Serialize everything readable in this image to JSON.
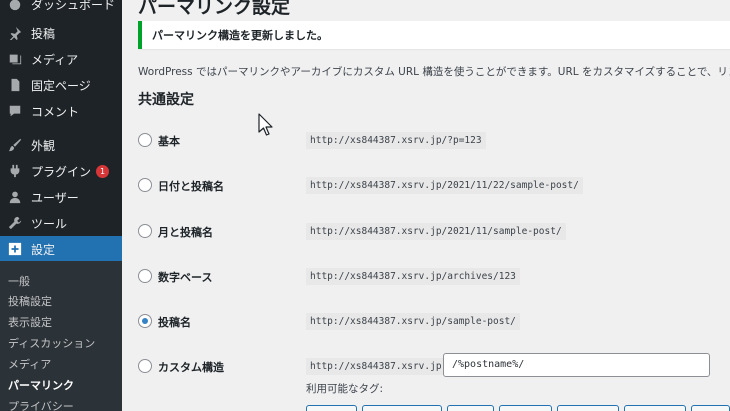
{
  "sidebar": {
    "items": [
      {
        "label": "ダッシュボード",
        "icon": "dashboard-icon"
      },
      {
        "label": "投稿",
        "icon": "pin-icon"
      },
      {
        "label": "メディア",
        "icon": "media-icon"
      },
      {
        "label": "固定ページ",
        "icon": "page-icon"
      },
      {
        "label": "コメント",
        "icon": "comment-icon"
      },
      {
        "label": "外観",
        "icon": "brush-icon"
      },
      {
        "label": "プラグイン",
        "icon": "plugin-icon",
        "badge": "1"
      },
      {
        "label": "ユーザー",
        "icon": "user-icon"
      },
      {
        "label": "ツール",
        "icon": "wrench-icon"
      },
      {
        "label": "設定",
        "icon": "settings-icon"
      }
    ],
    "submenu": [
      "一般",
      "投稿設定",
      "表示設定",
      "ディスカッション",
      "メディア",
      "パーマリンク",
      "プライバシー"
    ]
  },
  "page": {
    "title": "パーマリンク設定",
    "notice": "パーマリンク構造を更新しました。",
    "intro": "WordPress ではパーマリンクやアーカイブにカスタム URL 構造を使うことができます。URL をカスタマイズすることで、リンクの美し",
    "section_title": "共通設定",
    "tags_label": "利用可能なタグ:"
  },
  "options": [
    {
      "label": "基本",
      "example": "http://xs844387.xsrv.jp/?p=123",
      "checked": false
    },
    {
      "label": "日付と投稿名",
      "example": "http://xs844387.xsrv.jp/2021/11/22/sample-post/",
      "checked": false
    },
    {
      "label": "月と投稿名",
      "example": "http://xs844387.xsrv.jp/2021/11/sample-post/",
      "checked": false
    },
    {
      "label": "数字ベース",
      "example": "http://xs844387.xsrv.jp/archives/123",
      "checked": false
    },
    {
      "label": "投稿名",
      "example": "http://xs844387.xsrv.jp/sample-post/",
      "checked": true
    },
    {
      "label": "カスタム構造",
      "example": "http://xs844387.xsrv.jp",
      "checked": false
    }
  ],
  "custom_structure": {
    "value": "/%postname%/"
  },
  "colors": {
    "accent": "#2271b1",
    "success": "#00a32a",
    "sidebar_bg": "#1d2327"
  }
}
